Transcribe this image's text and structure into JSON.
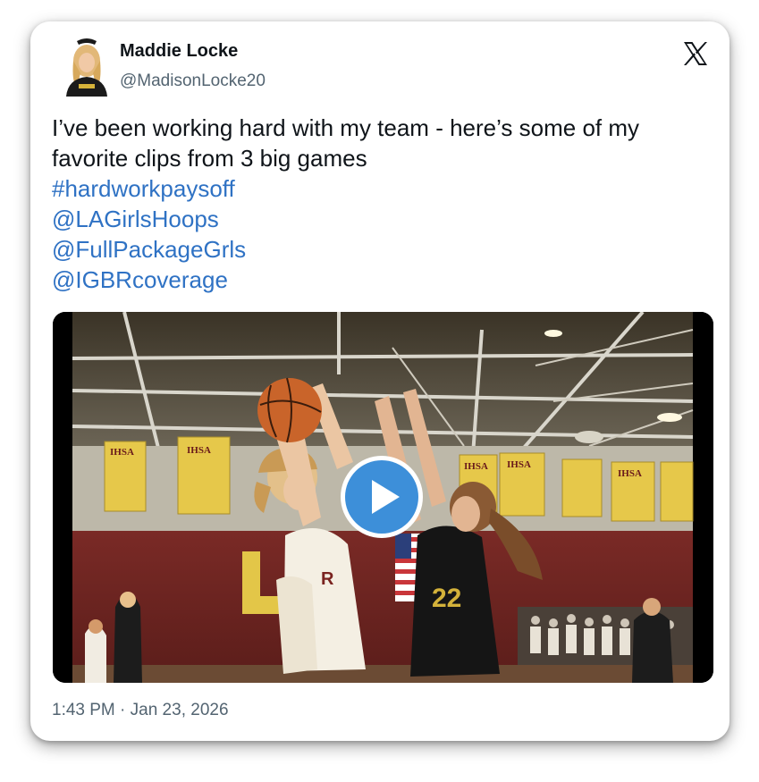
{
  "author": {
    "name": "Maddie Locke",
    "handle": "@MadisonLocke20",
    "avatar_icon": "avatar-photo"
  },
  "platform_icon": "x-logo-icon",
  "tweet": {
    "text_line_1": "I’ve been working hard with my team - here’s some of my",
    "text_line_2": "favorite clips from 3 big games",
    "hashtag": "#hardworkpaysoff",
    "mentions": [
      "@LAGirlsHoops",
      "@FullPackageGrls",
      "@IGBRcoverage"
    ]
  },
  "media": {
    "type": "video",
    "play_icon": "play-icon",
    "banners": [
      "IHSA",
      "IHSA",
      "IHSA",
      "IHSA",
      "IHSA"
    ],
    "jersey_number_away": "22"
  },
  "timestamp": "1:43 PM · Jan 23, 2026",
  "colors": {
    "link": "#2f72c4",
    "play_button": "#3d8fd9",
    "text": "#0f1419",
    "muted": "#536471"
  }
}
